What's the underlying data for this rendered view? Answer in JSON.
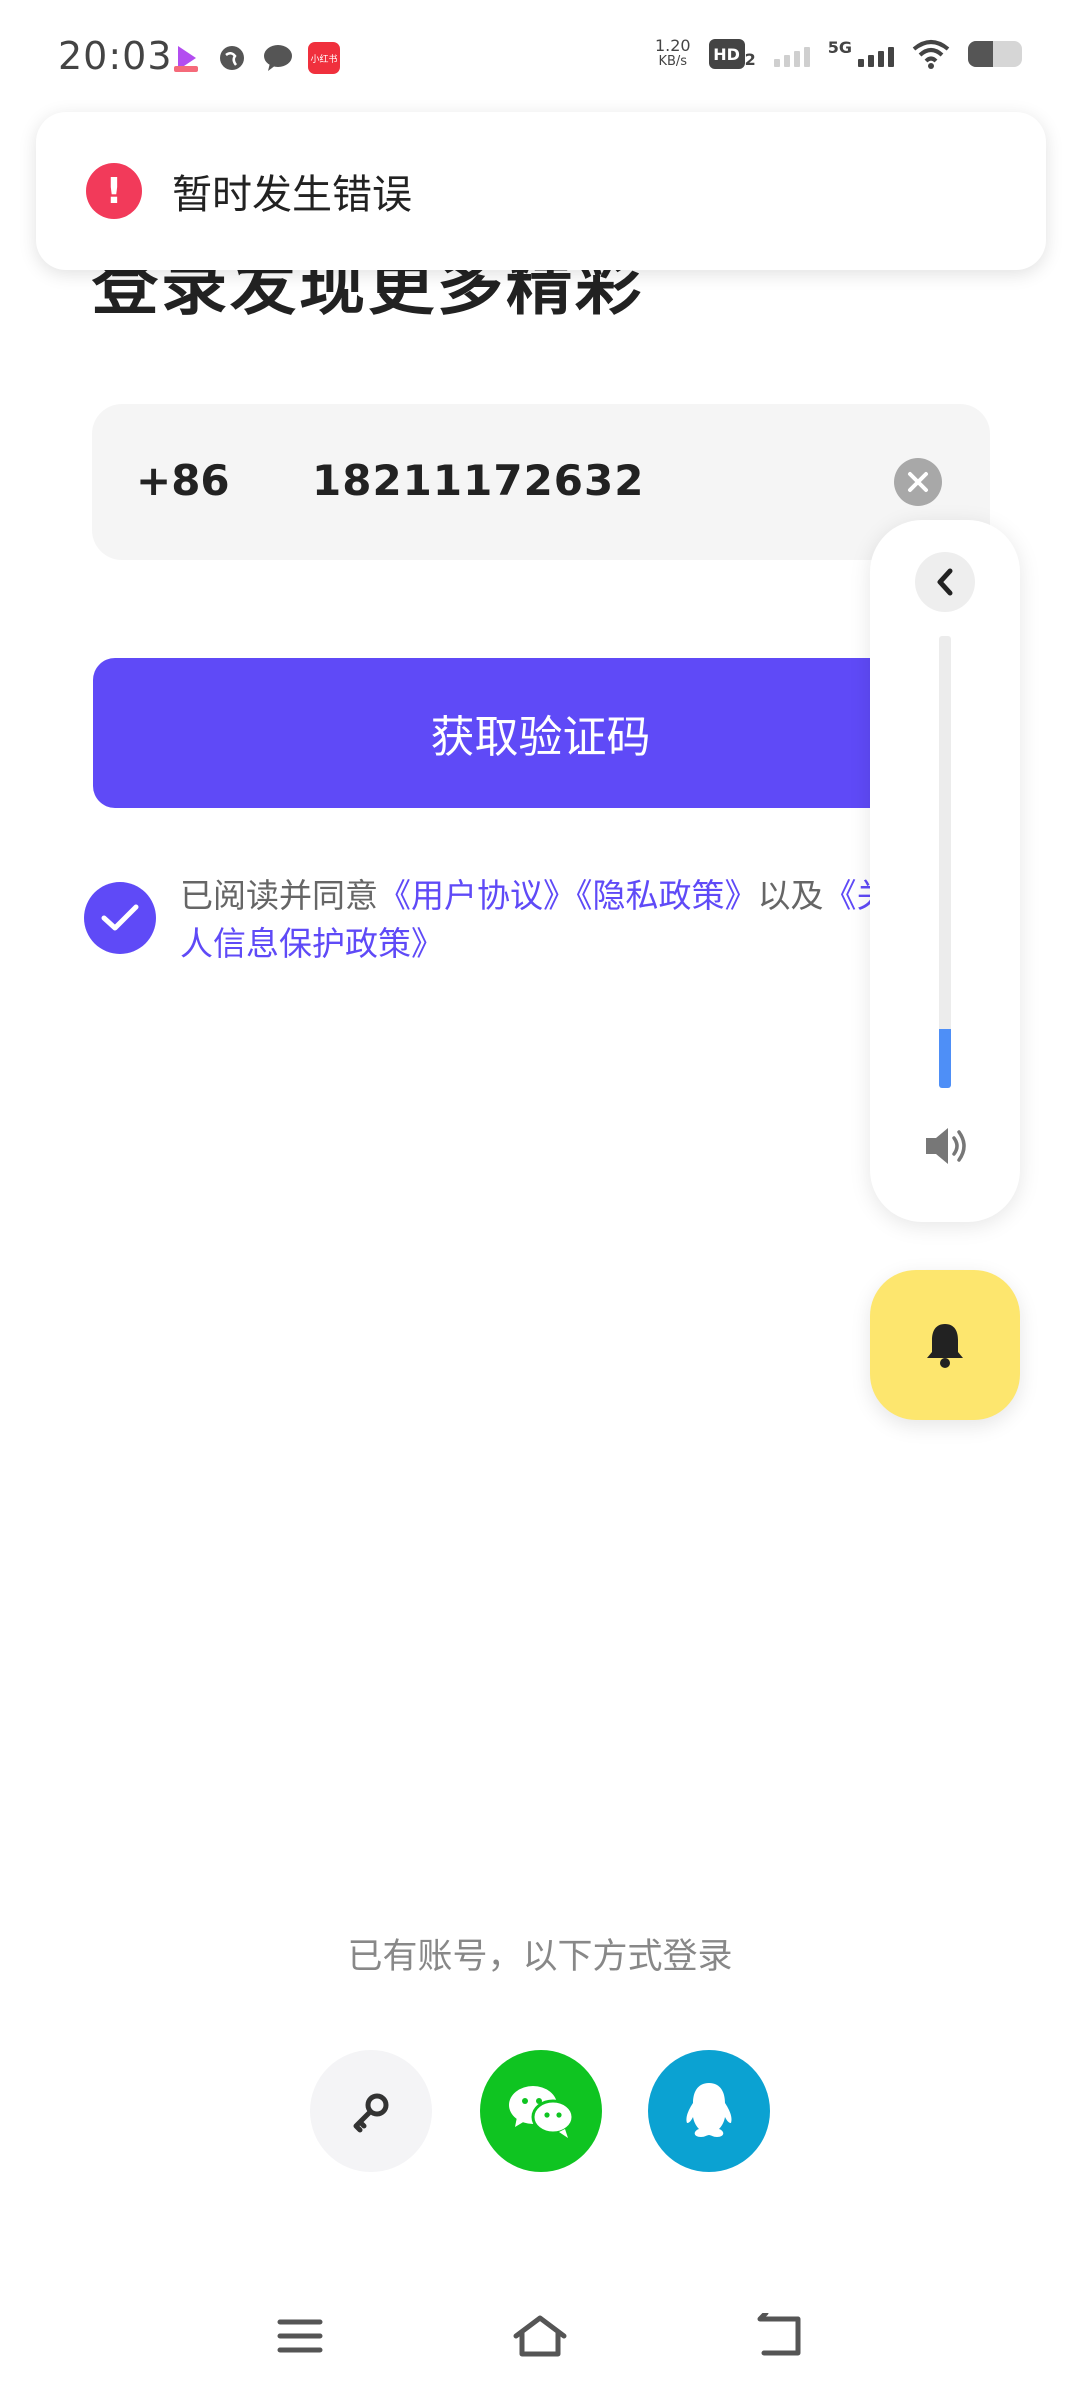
{
  "status_bar": {
    "time": "20:03",
    "net_speed_value": "1.20",
    "net_speed_unit": "KB/s",
    "hd_label": "HD",
    "hd_sub": "2",
    "network_type": "5G",
    "app_icon_4_text": "小红书"
  },
  "page": {
    "title": "登录发现更多精彩"
  },
  "toast": {
    "icon": "!",
    "message": "暂时发生错误"
  },
  "phone_input": {
    "country_code": "+86",
    "value": "18211172632"
  },
  "primary_button": {
    "label": "获取验证码"
  },
  "agreement": {
    "checked": true,
    "prefix": "已阅读并同意",
    "user_agreement": "《用户协议》",
    "privacy_policy": "《隐私政策》",
    "conjunction": "以及",
    "personal_info_policy": "《关于个人信息保护政策》"
  },
  "volume_panel": {
    "level_fraction": 0.13
  },
  "alt_login": {
    "label": "已有账号，以下方式登录",
    "options": [
      "key-icon",
      "wechat-icon",
      "qq-icon"
    ]
  },
  "colors": {
    "accent": "#5f4af7",
    "error": "#f23a5a",
    "wechat": "#0fc421",
    "qq": "#0ba2d2",
    "bell_bg": "#fde66e",
    "volume_fill": "#4e8ff7"
  }
}
